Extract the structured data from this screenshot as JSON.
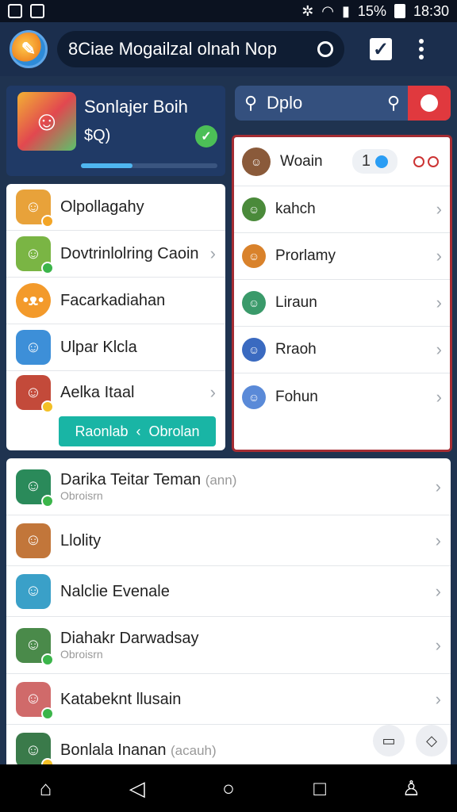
{
  "status": {
    "battery": "15%",
    "time": "18:30"
  },
  "header": {
    "title": "8Ciae Mogailzal olnah Nop"
  },
  "profile": {
    "name": "Sonlajer Boih",
    "sub": "$Q)",
    "progress": 0.38
  },
  "search": {
    "value": "Dplo"
  },
  "left_list": {
    "items": [
      {
        "label": "Olpollagahy"
      },
      {
        "label": "Dovtrinlolring Caoin"
      },
      {
        "label": "Facarkadiahan"
      },
      {
        "label": "Ulpar Klcla"
      },
      {
        "label": "Aelka Itaal"
      }
    ],
    "action": {
      "left": "Raonlab",
      "right": "Obrolan"
    }
  },
  "right_list": {
    "head": {
      "label": "Woain",
      "count": "1"
    },
    "items": [
      {
        "label": "kahch"
      },
      {
        "label": "Prorlamy"
      },
      {
        "label": "Liraun"
      },
      {
        "label": "Rraoh"
      },
      {
        "label": "Fohun"
      }
    ]
  },
  "contacts": [
    {
      "name": "Darika Teitar Teman",
      "aux": "(ann)",
      "sub": "Obroisrn"
    },
    {
      "name": "Llolity",
      "aux": "",
      "sub": ""
    },
    {
      "name": "Nalclie Evenale",
      "aux": "",
      "sub": ""
    },
    {
      "name": "Diahakr Darwadsay",
      "aux": "",
      "sub": "Obroisrn"
    },
    {
      "name": "Katabeknt llusain",
      "aux": "",
      "sub": ""
    },
    {
      "name": "Bonlala Inanan",
      "aux": "(acauh)",
      "sub": ""
    }
  ]
}
